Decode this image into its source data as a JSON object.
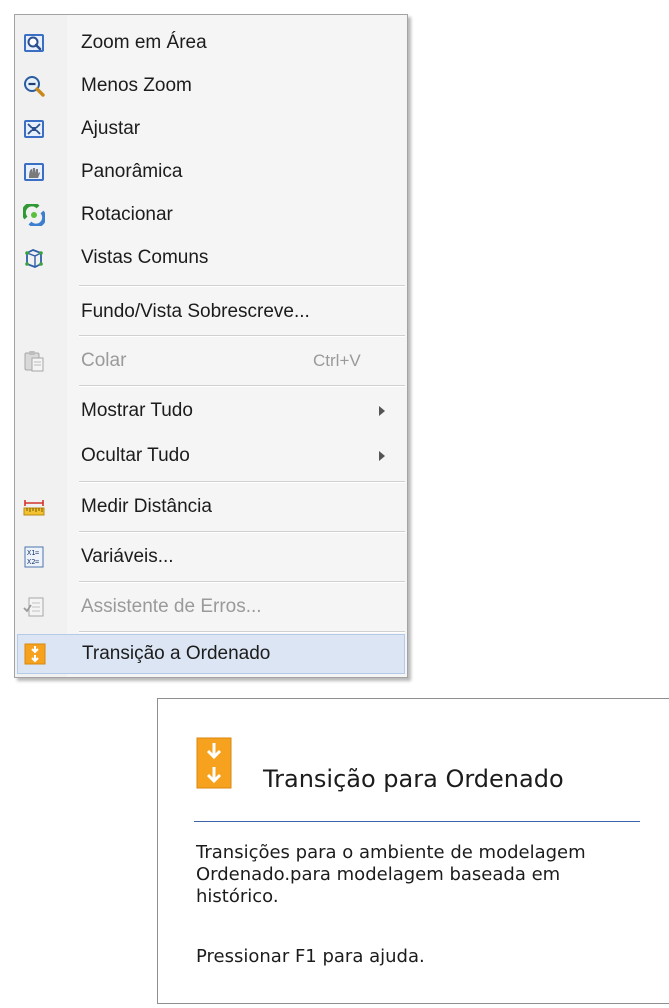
{
  "context_menu": {
    "items": [
      {
        "label": "Zoom em Área",
        "icon": "zoom-area-icon"
      },
      {
        "label": "Menos Zoom",
        "icon": "zoom-out-icon"
      },
      {
        "label": "Ajustar",
        "icon": "fit-icon"
      },
      {
        "label": "Panorâmica",
        "icon": "pan-icon"
      },
      {
        "label": "Rotacionar",
        "icon": "rotate-icon"
      },
      {
        "label": "Vistas Comuns",
        "icon": "common-views-icon"
      },
      {
        "label": "Fundo/Vista Sobrescreve..."
      },
      {
        "label": "Colar",
        "icon": "paste-icon",
        "shortcut": "Ctrl+V",
        "disabled": true
      },
      {
        "label": "Mostrar Tudo",
        "submenu": true
      },
      {
        "label": "Ocultar Tudo",
        "submenu": true
      },
      {
        "label": "Medir Distância",
        "icon": "measure-distance-icon"
      },
      {
        "label": "Variáveis...",
        "icon": "variables-icon"
      },
      {
        "label": "Assistente de Erros...",
        "icon": "error-assistant-icon",
        "disabled": true
      },
      {
        "label": "Transição a Ordenado",
        "icon": "transition-ordered-icon",
        "selected": true
      }
    ]
  },
  "tooltip": {
    "icon": "transition-ordered-icon",
    "title": "Transição para Ordenado",
    "description": "Transições para o ambiente de modelagem Ordenado.para modelagem baseada em histórico.",
    "help": "Pressionar F1 para ajuda."
  },
  "colors": {
    "menu_background": "#f5f5f5",
    "menu_border": "#a3a3a3",
    "highlight": "#dbe5f3",
    "highlight_border": "#b5c9e8",
    "tooltip_rule": "#3b64ad",
    "transition_icon": "#f6a21e"
  }
}
